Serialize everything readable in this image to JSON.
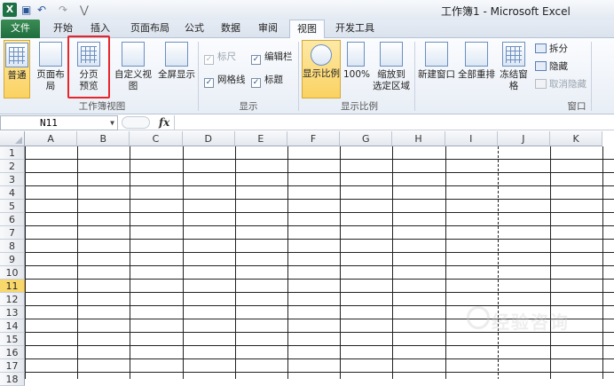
{
  "window": {
    "title": "工作簿1 - Microsoft Excel"
  },
  "qat": {
    "logo": "X",
    "save": "▣",
    "undo": "↶",
    "redo": "↷",
    "customize": "⋁"
  },
  "tabs": [
    "文件",
    "开始",
    "插入",
    "页面布局",
    "公式",
    "数据",
    "审阅",
    "视图",
    "开发工具"
  ],
  "active_tab": "视图",
  "ribbon": {
    "workbook_views": {
      "label": "工作簿视图",
      "normal": "普通",
      "page_layout": "页面布局",
      "page_break_preview_1": "分页",
      "page_break_preview_2": "预览",
      "custom_views": "自定义视图",
      "full_screen": "全屏显示"
    },
    "show": {
      "label": "显示",
      "ruler": "标尺",
      "formula_bar": "编辑栏",
      "gridlines": "网格线",
      "headings": "标题"
    },
    "zoom": {
      "label": "显示比例",
      "zoom": "显示比例",
      "hundred": "100%",
      "to_selection_1": "缩放到",
      "to_selection_2": "选定区域"
    },
    "window": {
      "label": "窗口",
      "new_window": "新建窗口",
      "arrange_all": "全部重排",
      "freeze_panes": "冻结窗格",
      "split": "拆分",
      "hide": "隐藏",
      "unhide": "取消隐藏"
    }
  },
  "formula_bar": {
    "name_box": "N11",
    "fx": "fx",
    "value": ""
  },
  "grid": {
    "columns": [
      "A",
      "B",
      "C",
      "D",
      "E",
      "F",
      "G",
      "H",
      "I",
      "J",
      "K"
    ],
    "rows": [
      "1",
      "2",
      "3",
      "4",
      "5",
      "6",
      "7",
      "8",
      "9",
      "10",
      "11",
      "12",
      "13",
      "14",
      "15",
      "16",
      "17",
      "18"
    ],
    "active_row": "11"
  },
  "watermark": {
    "text": "经验咨询"
  }
}
